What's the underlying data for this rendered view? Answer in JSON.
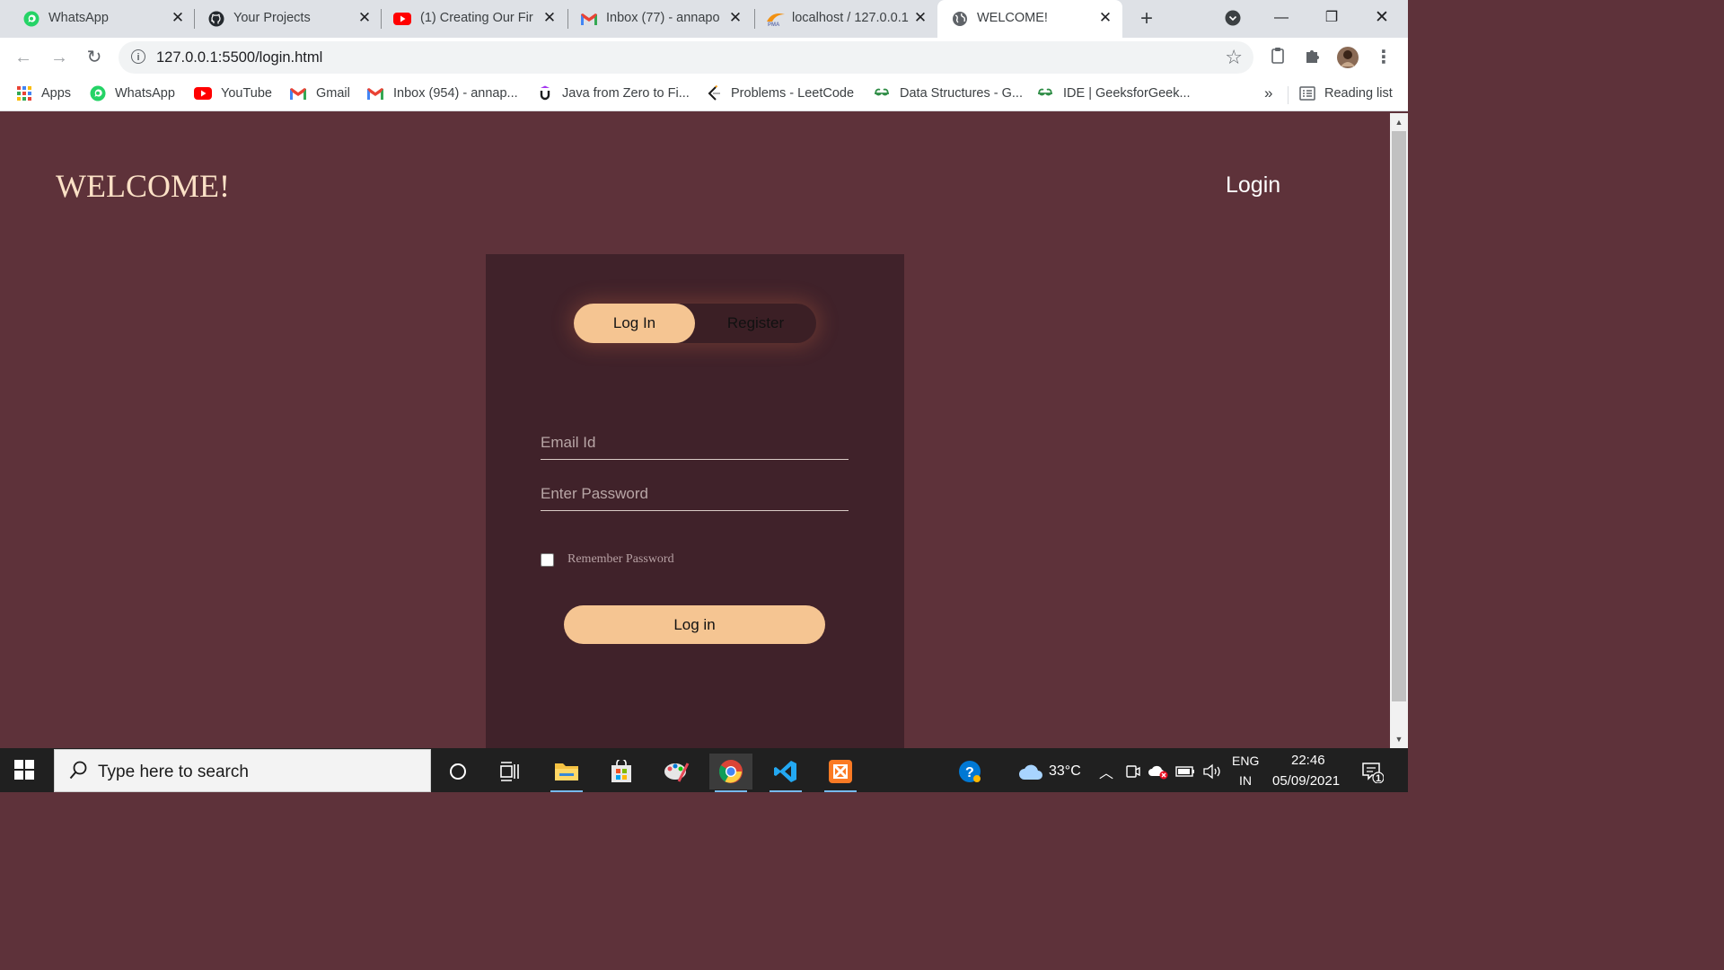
{
  "browser": {
    "tabs": [
      {
        "title": "WhatsApp",
        "icon": "whatsapp-icon"
      },
      {
        "title": "Your Projects",
        "icon": "github-icon"
      },
      {
        "title": "(1) Creating Our Fir",
        "icon": "youtube-icon"
      },
      {
        "title": "Inbox (77) - annapo",
        "icon": "gmail-icon"
      },
      {
        "title": "localhost / 127.0.0.1",
        "icon": "phpmyadmin-icon"
      },
      {
        "title": "WELCOME!",
        "icon": "globe-icon",
        "active": true
      }
    ],
    "url": "127.0.0.1:5500/login.html",
    "bookmarks": [
      {
        "label": "Apps",
        "icon": "apps-grid-icon"
      },
      {
        "label": "WhatsApp",
        "icon": "whatsapp-icon"
      },
      {
        "label": "YouTube",
        "icon": "youtube-icon"
      },
      {
        "label": "Gmail",
        "icon": "gmail-icon"
      },
      {
        "label": "Inbox (954) - annap...",
        "icon": "gmail-icon"
      },
      {
        "label": "Java from Zero to Fi...",
        "icon": "udemy-icon"
      },
      {
        "label": "Problems - LeetCode",
        "icon": "leetcode-icon"
      },
      {
        "label": "Data Structures - G...",
        "icon": "geeksforgeeks-icon"
      },
      {
        "label": "IDE | GeeksforGeek...",
        "icon": "geeksforgeeks-icon"
      }
    ],
    "overflow_label": "»",
    "reading_list": "Reading list"
  },
  "page": {
    "title": "WELCOME!",
    "nav_login": "Login",
    "toggle": {
      "login": "Log In",
      "register": "Register"
    },
    "email_placeholder": "Email Id",
    "password_placeholder": "Enter Password",
    "remember": "Remember Password",
    "submit": "Log in"
  },
  "taskbar": {
    "search_placeholder": "Type here to search",
    "temperature": "33°C",
    "lang_top": "ENG",
    "lang_bottom": "IN",
    "time": "22:46",
    "date": "05/09/2021",
    "notifications": "1"
  },
  "colors": {
    "page_bg": "#5e323a",
    "card_bg": "#40222a",
    "accent": "#f5c592",
    "title_text": "#fbe1c6"
  }
}
